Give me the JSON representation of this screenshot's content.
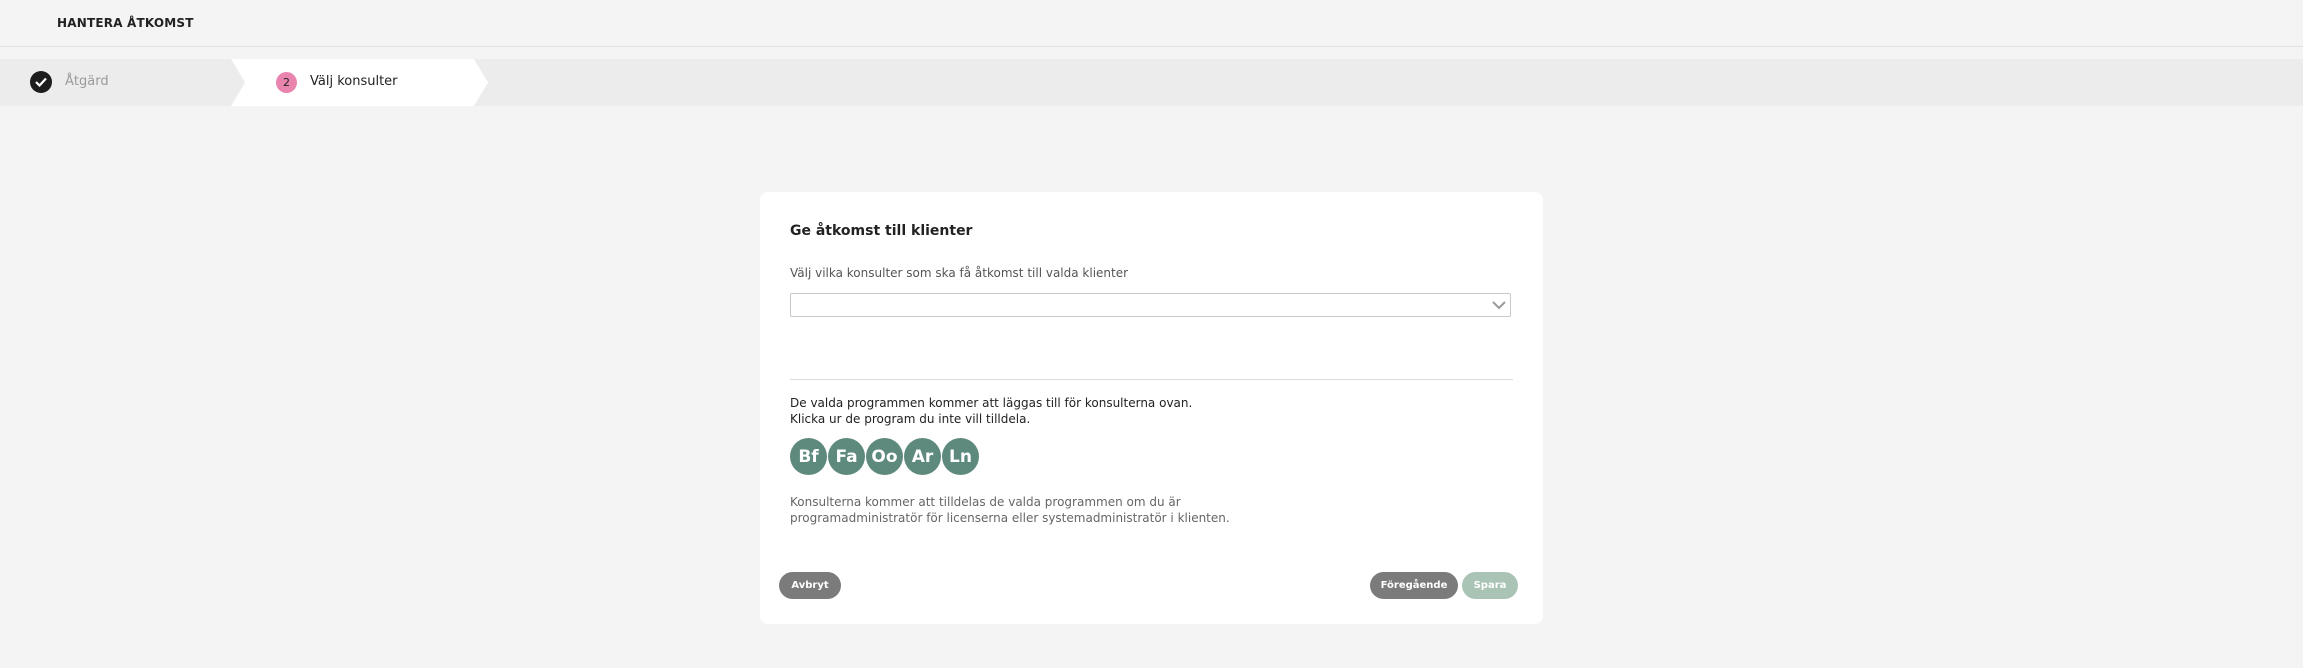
{
  "header": {
    "title": "HANTERA ÅTKOMST"
  },
  "steps": [
    {
      "label": "Åtgärd",
      "state": "completed",
      "icon": "checkmark-icon"
    },
    {
      "number": "2",
      "label": "Välj konsulter",
      "state": "active"
    }
  ],
  "card": {
    "title": "Ge åtkomst till klienter",
    "select_label": "Välj vilka konsulter som ska få åtkomst till valda klienter",
    "select_value": "",
    "info_line1": "De valda programmen kommer att läggas till för konsulterna ovan.",
    "info_line2": "Klicka ur de program du inte vill tilldela.",
    "programs": [
      "Bf",
      "Fa",
      "Oo",
      "Ar",
      "Ln"
    ],
    "note_line1": "Konsulterna kommer att tilldelas de valda programmen om du är",
    "note_line2": "programadministratör för licenserna eller systemadministratör i klienten."
  },
  "buttons": {
    "cancel": "Avbryt",
    "previous": "Föregående",
    "save": "Spara"
  },
  "colors": {
    "accent_pink": "#e884ae",
    "program_green": "#5e8a7e",
    "button_gray": "#7b7b7b",
    "save_disabled": "#a9c4b5"
  }
}
